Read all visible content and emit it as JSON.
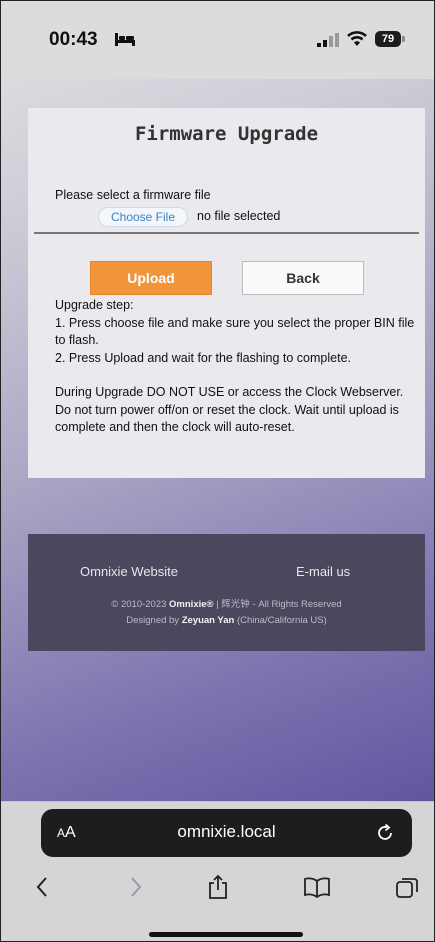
{
  "status": {
    "time": "00:43",
    "battery": "79"
  },
  "page": {
    "title": "Firmware Upgrade",
    "select_label": "Please select a firmware file",
    "choose_file": "Choose File",
    "no_file": "no file selected",
    "upload": "Upload",
    "back": "Back",
    "step_heading": "Upgrade step:",
    "step1": "1. Press choose file and make sure you select the proper BIN file to flash.",
    "step2": "2. Press Upload and wait for the flashing to complete.",
    "warning": "During Upgrade DO NOT USE or access the Clock Webserver. Do not turn power off/on or reset the clock. Wait until upload is complete and then the clock will auto-reset."
  },
  "footer": {
    "link_website": "Omnixie Website",
    "link_email": "E-mail us",
    "copyright_prefix": "© 2010-2023",
    "brand": "Omnixie®",
    "brand_cn": "| 辉光钟",
    "rights": "- All Rights Reserved",
    "designed_by": "Designed by",
    "designer": "Zeyuan Yan",
    "location": "(China/California US)"
  },
  "browser": {
    "aa_label_small": "A",
    "aa_label_big": "A",
    "url": "omnixie.local"
  },
  "icons": {
    "status": [
      "bed-icon",
      "signal-icon",
      "wifi-icon",
      "battery-icon"
    ],
    "toolbar": [
      "back-icon",
      "forward-icon",
      "share-icon",
      "bookmarks-icon",
      "tabs-icon",
      "reload-icon"
    ]
  }
}
